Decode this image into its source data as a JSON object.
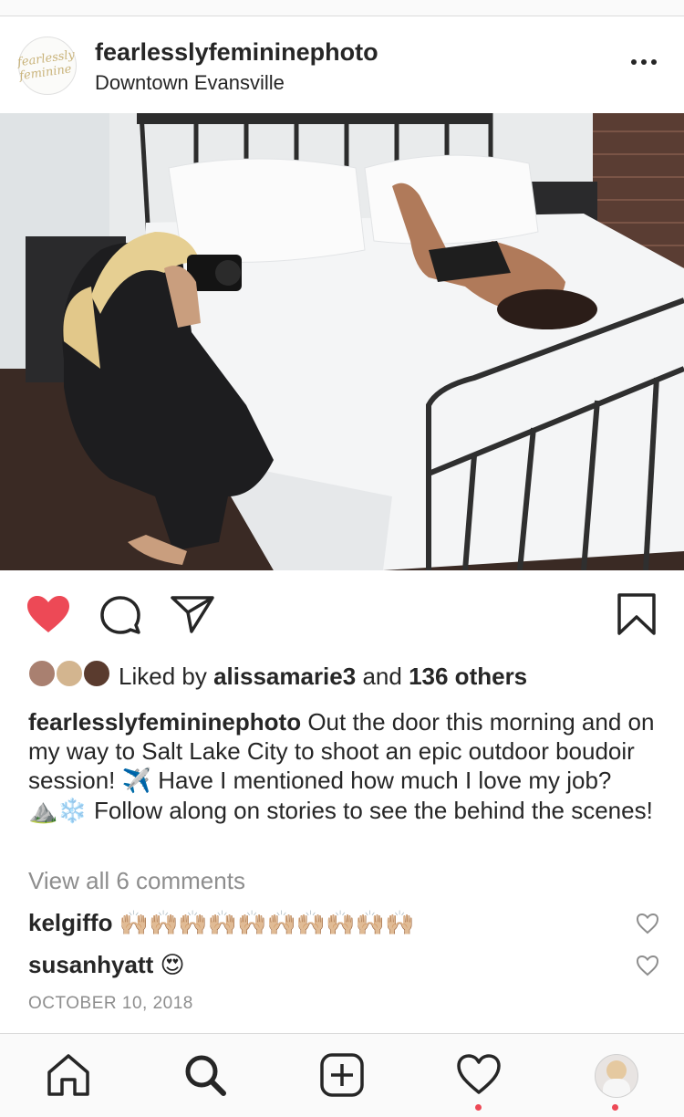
{
  "post": {
    "username": "fearlesslyfemininephoto",
    "location": "Downtown Evansville",
    "avatar_logo_text": "fearlessly feminine"
  },
  "icons": {
    "more": "more-options-icon",
    "like": "heart-filled-icon",
    "comment": "comment-bubble-icon",
    "share": "paper-plane-icon",
    "save": "bookmark-icon"
  },
  "likes": {
    "prefix": "Liked by",
    "user": "alissamarie3",
    "connector": "and",
    "others": "136 others"
  },
  "caption": {
    "username": "fearlesslyfemininephoto",
    "text_1": "Out the door this morning and on my way to Salt Lake City to shoot an epic outdoor boudoir session!",
    "emoji_1": "✈️",
    "text_2": "Have I mentioned how much I love my job?",
    "emoji_2": "⛰️❄️",
    "text_3": "Follow along on stories to see the behind the scenes!"
  },
  "view_all": "View all 6 comments",
  "comments": [
    {
      "username": "kelgiffo",
      "text": "🙌🏼🙌🏼🙌🏼🙌🏼🙌🏼🙌🏼🙌🏼🙌🏼🙌🏼🙌🏼"
    },
    {
      "username": "susanhyatt",
      "text": "😍"
    }
  ],
  "date": "OCTOBER 10, 2018",
  "tabbar": [
    "home-icon",
    "search-icon",
    "new-post-icon",
    "activity-icon",
    "profile-avatar"
  ],
  "colors": {
    "like_red": "#ed4956",
    "text": "#262626",
    "muted": "#8e8e8e"
  }
}
